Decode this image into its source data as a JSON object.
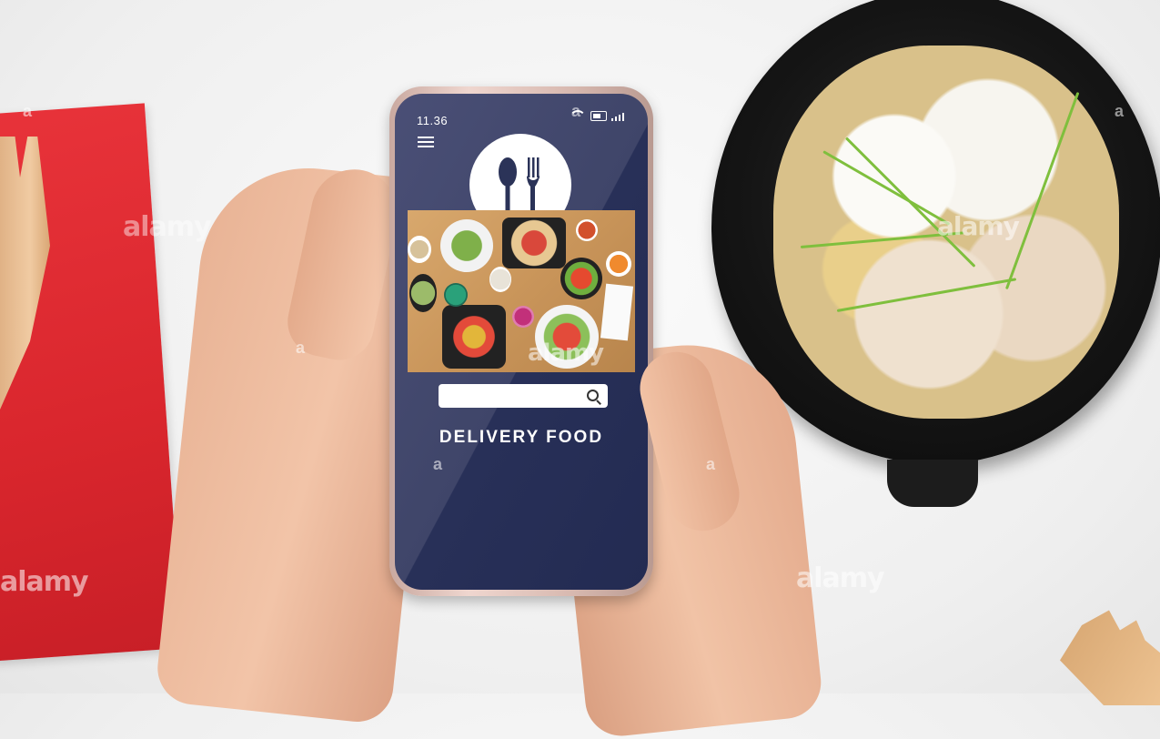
{
  "phone": {
    "status_time": "11.36",
    "app": {
      "title": "DELIVERY FOOD",
      "search": {
        "value": "",
        "placeholder": ""
      }
    }
  },
  "watermarks": [
    "alamy",
    "alamy",
    "alamy",
    "alamy",
    "alamy",
    "a",
    "a",
    "a",
    "a",
    "a",
    "a"
  ],
  "icons": [
    "menu-icon",
    "spoon-fork-icon",
    "search-icon",
    "wifi-icon",
    "battery-icon",
    "signal-icon"
  ],
  "colors": {
    "screen": "#2b3358",
    "screen_light": "#454a72",
    "napkin": "#d9262d",
    "accent_text": "#ffffff"
  }
}
